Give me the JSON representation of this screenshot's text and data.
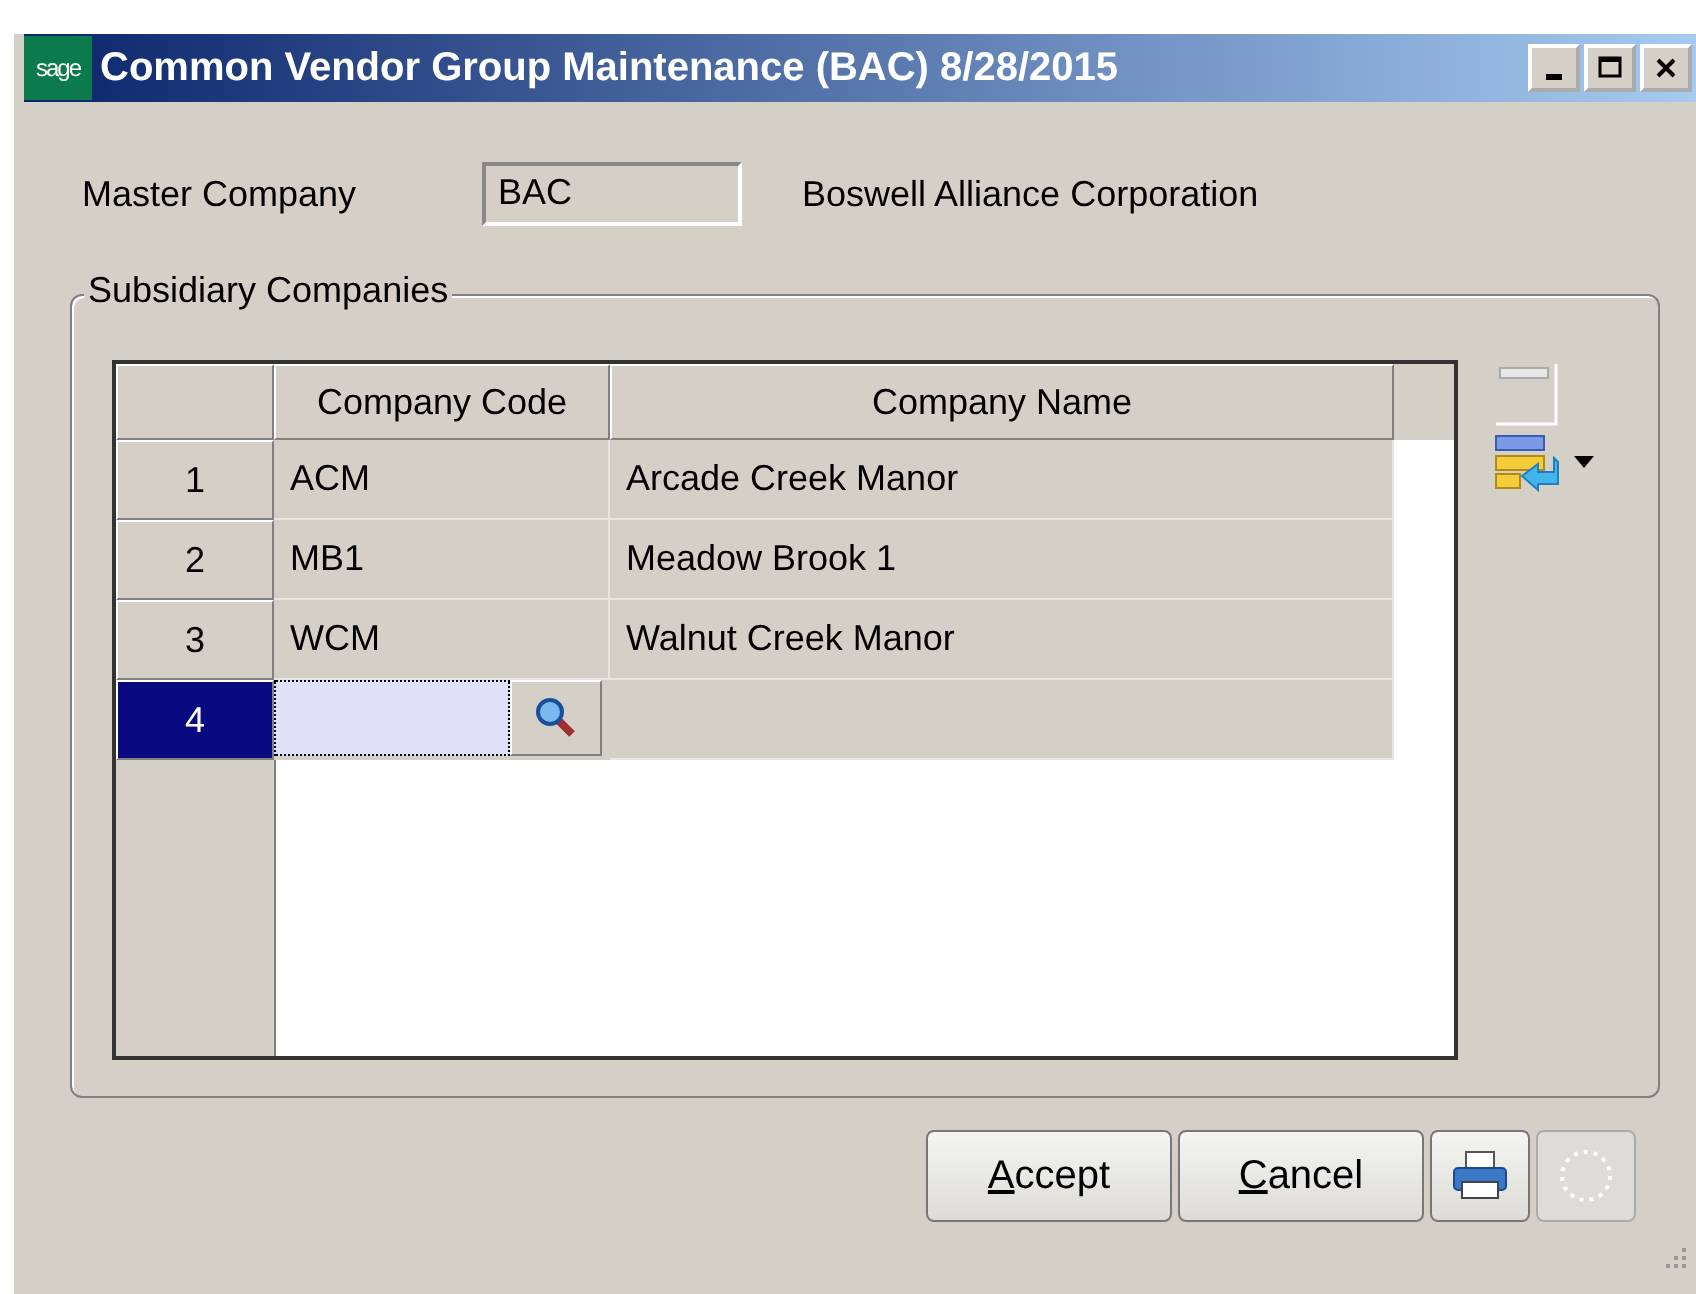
{
  "window": {
    "title": "Common Vendor Group Maintenance (BAC) 8/28/2015",
    "logo": "sage"
  },
  "master_company": {
    "label": "Master Company",
    "code": "BAC",
    "name": "Boswell Alliance Corporation"
  },
  "subsidiary_companies": {
    "title": "Subsidiary Companies",
    "columns": [
      "Company Code",
      "Company Name"
    ],
    "rows": [
      {
        "kind": "data",
        "number": "1",
        "code": "ACM",
        "name": "Arcade Creek Manor",
        "selected": false
      },
      {
        "kind": "data",
        "number": "2",
        "code": "MB1",
        "name": "Meadow Brook 1",
        "selected": false
      },
      {
        "kind": "data",
        "number": "3",
        "code": "WCM",
        "name": "Walnut Creek Manor",
        "selected": false
      },
      {
        "kind": "entry",
        "number": "4",
        "selected": true
      }
    ]
  },
  "buttons": [
    {
      "key": "A",
      "rest": "ccept"
    },
    {
      "key": "C",
      "rest": "ancel"
    }
  ]
}
